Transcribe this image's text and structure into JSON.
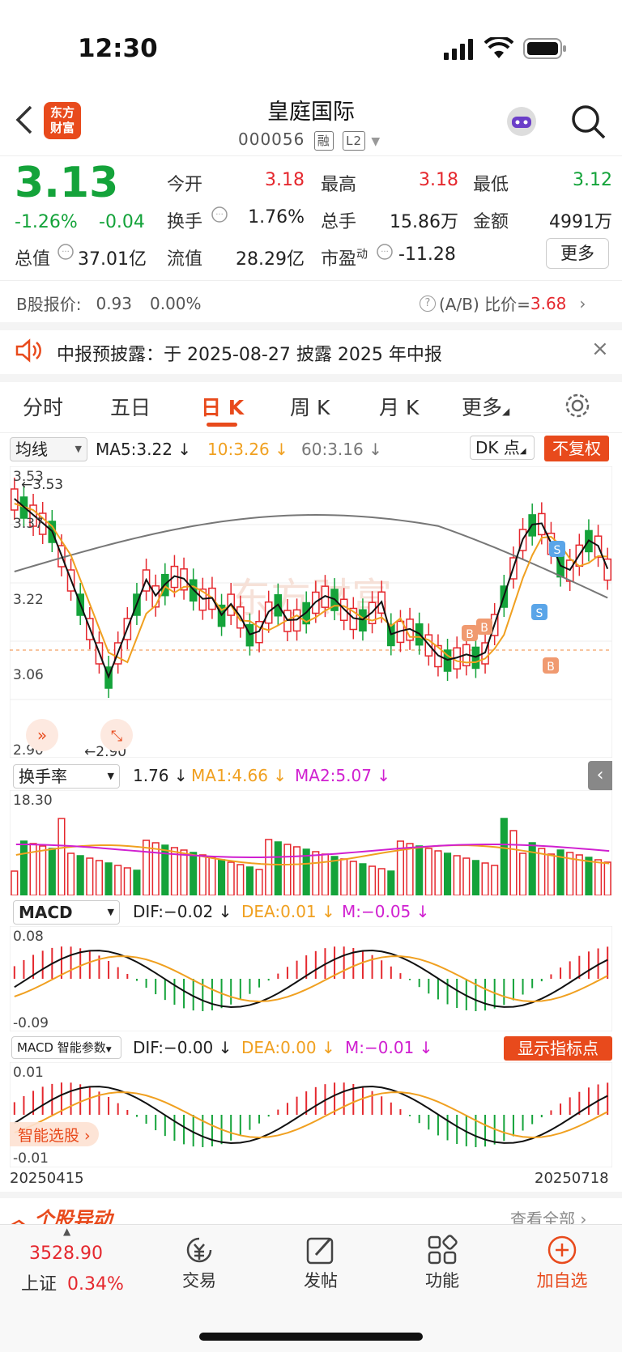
{
  "status_bar": {
    "time": "12:30"
  },
  "header": {
    "logo_text": [
      "东方",
      "财富"
    ],
    "stock_name": "皇庭国际",
    "stock_code": "000056",
    "tags": [
      "融",
      "L2"
    ]
  },
  "quote": {
    "price": "3.13",
    "change_pct": "-1.26%",
    "change_abs": "-0.04",
    "fields": [
      {
        "label": "今开",
        "value": "3.18",
        "color": "red"
      },
      {
        "label": "最高",
        "value": "3.18",
        "color": "red"
      },
      {
        "label": "最低",
        "value": "3.12",
        "color": "green"
      },
      {
        "label": "换手",
        "value": "1.76%",
        "color": "black"
      },
      {
        "label": "总手",
        "value": "15.86万",
        "color": "black"
      },
      {
        "label": "金额",
        "value": "4991万",
        "color": "black"
      },
      {
        "label": "总值",
        "value": "37.01亿",
        "color": "black"
      },
      {
        "label": "流值",
        "value": "28.29亿",
        "color": "black"
      },
      {
        "label": "市盈",
        "value": "-11.28",
        "color": "black"
      }
    ],
    "pe_superscript": "动",
    "more_label": "更多"
  },
  "b_share": {
    "label": "B股报价:",
    "price": "0.93",
    "pct": "0.00%",
    "ratio_label": "(A/B) 比价=",
    "ratio_value": "3.68"
  },
  "notice": {
    "text": "中报预披露：于 2025-08-27 披露 2025 年中报"
  },
  "tabs": [
    "分时",
    "五日",
    "日 K",
    "周 K",
    "月 K",
    "更多"
  ],
  "active_tab": 2,
  "ma_bar": {
    "select": "均线",
    "ma5": "MA5:3.22",
    "ma10": "10:3.26",
    "ma60": "60:3.16",
    "dk_label": "DK 点",
    "fq_label": "不复权"
  },
  "kline": {
    "y_labels": [
      "3.53",
      "3.37",
      "3.22",
      "3.06",
      "2.90"
    ],
    "high_marker": "3.53",
    "low_marker": "2.90",
    "watermark": "东方财富"
  },
  "turnover": {
    "select": "换手率",
    "value": "1.76",
    "ma1": "MA1:4.66",
    "ma2": "MA2:5.07",
    "top_label": "18.30"
  },
  "macd": {
    "select": "MACD",
    "dif": "DIF:−0.02",
    "dea": "DEA:0.01",
    "m": "M:−0.05",
    "top_label": "0.08",
    "bottom_label": "-0.09"
  },
  "smart_macd": {
    "select": "MACD 智能参数",
    "dif": "DIF:−0.00",
    "dea": "DEA:0.00",
    "m": "M:−0.01",
    "show_points_label": "显示指标点",
    "top_label": "0.01",
    "bottom_label": "-0.01",
    "smart_pick_label": "智能选股",
    "date_start": "20250415",
    "date_end": "20250718"
  },
  "stock_movement": {
    "title": "个股异动",
    "view_all": "查看全部"
  },
  "bottom_nav": {
    "index_value": "3528.90",
    "index_name": "上证",
    "index_pct": "0.34%",
    "items": [
      "交易",
      "发帖",
      "功能",
      "加自选"
    ]
  },
  "chart_data": {
    "type": "candlestick",
    "date_range": [
      "20250415",
      "20250718"
    ],
    "y_range": [
      2.9,
      3.53
    ],
    "close_last": 3.13,
    "ma": {
      "MA5": 3.22,
      "MA10": 3.26,
      "MA60": 3.16
    }
  },
  "colors": {
    "up": "#e5282e",
    "down": "#14a33a",
    "accent": "#e84a1c"
  }
}
